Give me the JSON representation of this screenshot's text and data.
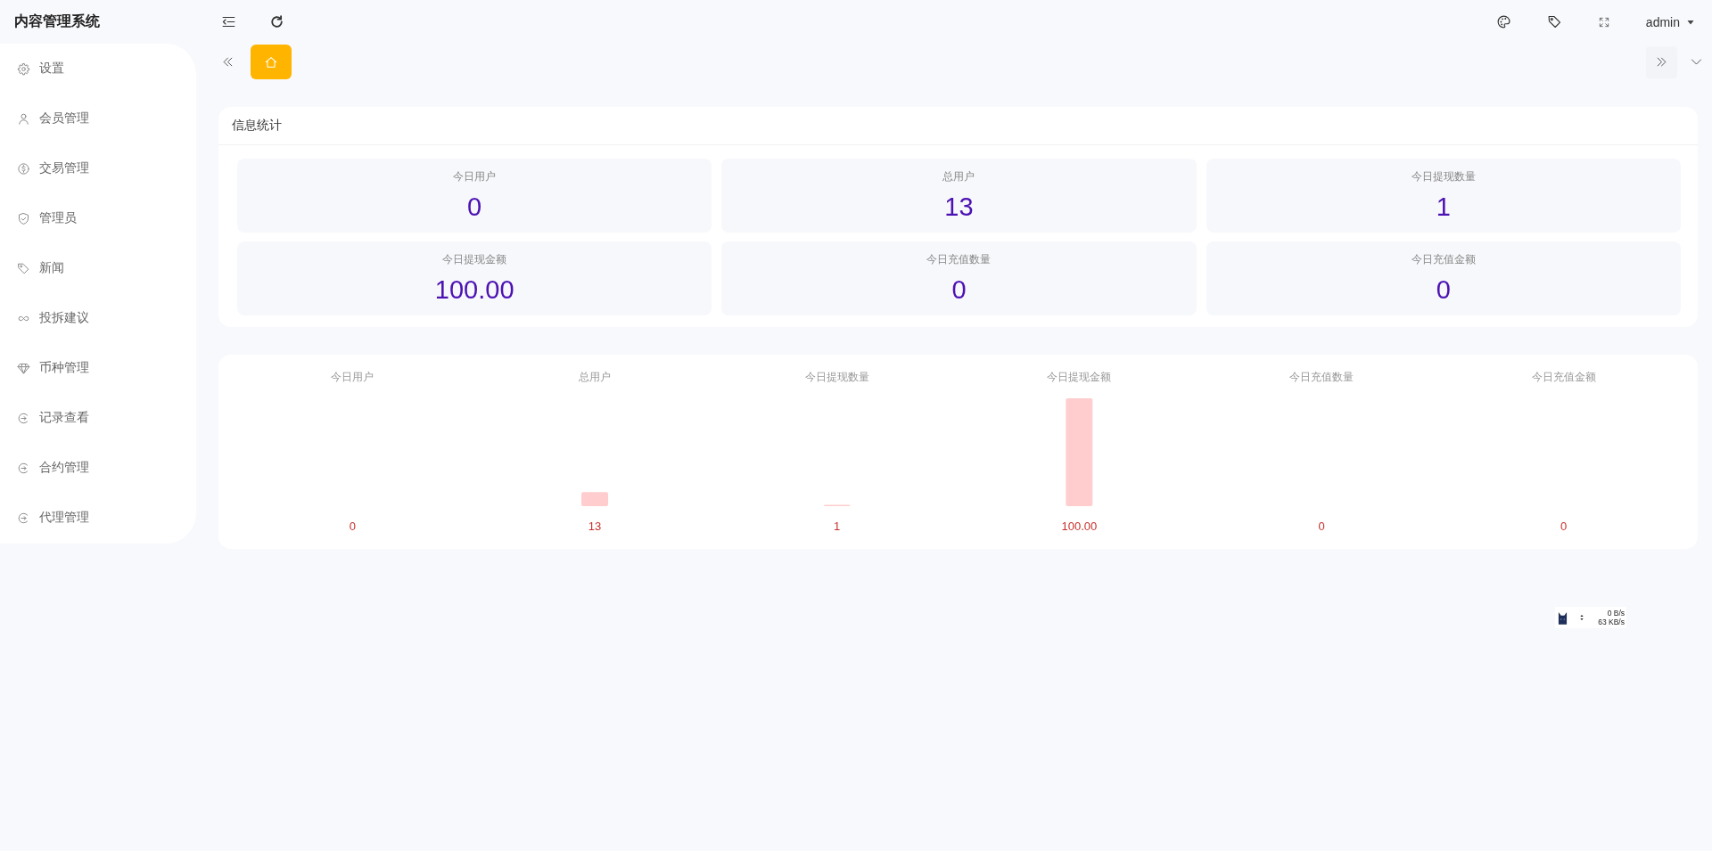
{
  "header": {
    "title": "内容管理系统",
    "user": "admin"
  },
  "sidebar": {
    "items": [
      {
        "label": "设置",
        "selected": false
      },
      {
        "label": "会员管理",
        "selected": false
      },
      {
        "label": "交易管理",
        "selected": false
      },
      {
        "label": "管理员",
        "selected": false
      },
      {
        "label": "新闻",
        "selected": false
      },
      {
        "label": "投拆建议",
        "selected": false
      },
      {
        "label": "币种管理",
        "selected": false
      },
      {
        "label": "记录查看",
        "selected": false
      },
      {
        "label": "合约管理",
        "selected": false
      },
      {
        "label": "代理管理",
        "selected": false
      }
    ]
  },
  "tabs": [
    {
      "selected": true
    }
  ],
  "stats": {
    "title": "信息统计",
    "items": [
      {
        "label": "今日用户",
        "value": "0"
      },
      {
        "label": "总用户",
        "value": "13"
      },
      {
        "label": "今日提现数量",
        "value": "1"
      },
      {
        "label": "今日提现金额",
        "value": "100.00"
      },
      {
        "label": "今日充值数量",
        "value": "0"
      },
      {
        "label": "今日充值金额",
        "value": "0"
      }
    ]
  },
  "chart": {
    "chart_data": {
      "type": "bar",
      "categories": [
        "今日用户",
        "总用户",
        "今日提现数量",
        "今日提现金额",
        "今日充值数量",
        "今日充值金额"
      ],
      "values": [
        0,
        13,
        1,
        100,
        0,
        0
      ],
      "value_labels": [
        "0",
        "13",
        "1",
        "100.00",
        "0",
        "0"
      ]
    }
  },
  "speed_widget": {
    "readings": [
      "0 B/s",
      "63 KB/s"
    ]
  }
}
